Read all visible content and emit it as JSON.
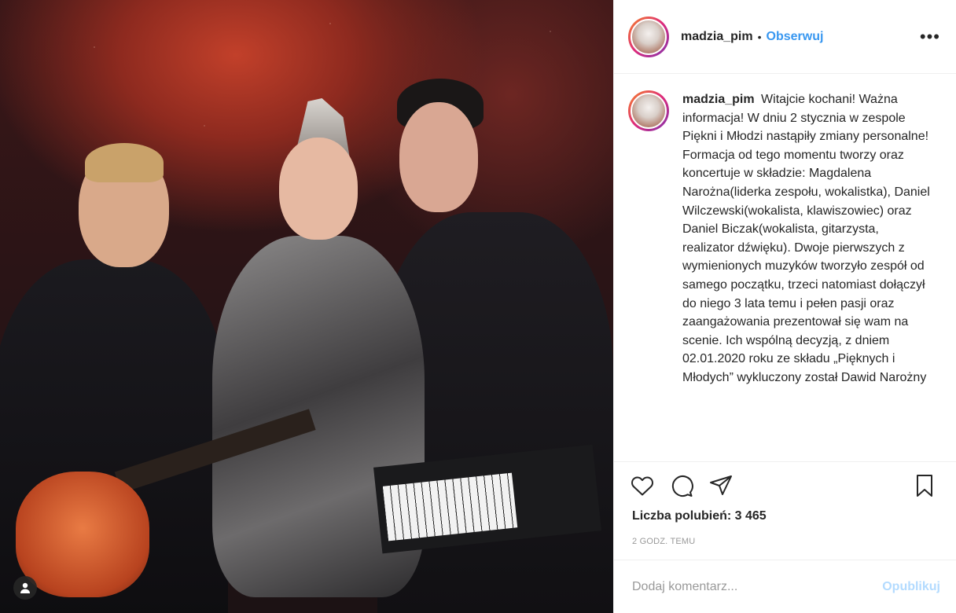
{
  "post": {
    "username": "madzia_pim",
    "separator": "•",
    "follow_label": "Obserwuj",
    "more_icon": "more-horizontal-icon",
    "more_glyph": "•••"
  },
  "caption": {
    "username": "madzia_pim",
    "text": "Witajcie kochani! Ważna informacja! W dniu 2 stycznia w zespole Piękni i Młodzi nastąpiły zmiany personalne! Formacja od tego momentu tworzy oraz koncertuje w składzie: Magdalena Narożna(liderka zespołu, wokalistka), Daniel Wilczewski(wokalista, klawiszowiec) oraz Daniel Biczak(wokalista, gitarzysta, realizator dźwięku). Dwoje pierwszych z wymienionych muzyków tworzyło zespół od samego początku, trzeci natomiast dołączył do niego 3 lata temu i pełen pasji oraz zaangażowania prezentował się wam na scenie. Ich wspólną decyzją, z dniem 02.01.2020 roku ze składu „Pięknych i Młodych” wykluczony został Dawid Narożny"
  },
  "actions": {
    "like_icon": "heart-icon",
    "comment_icon": "comment-icon",
    "share_icon": "share-icon",
    "save_icon": "bookmark-icon"
  },
  "likes_text": "Liczba polubień: 3 465",
  "timestamp": "2 GODZ. TEMU",
  "comment": {
    "placeholder": "Dodaj komentarz...",
    "publish_label": "Opublikuj"
  },
  "colors": {
    "accent": "#3897f0",
    "publish_disabled": "#b3dbff",
    "text": "#262626",
    "muted": "#999999"
  }
}
